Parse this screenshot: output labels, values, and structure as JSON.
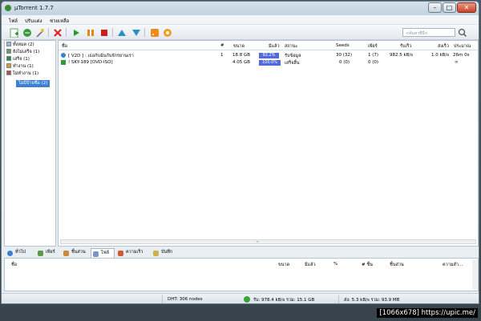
{
  "window": {
    "title": "µTorrent 1.7.7"
  },
  "menubar": {
    "items": [
      "ไฟล์",
      "ปรับแต่ง",
      "ช่วยเหลือ"
    ]
  },
  "toolbar": {
    "search_placeholder": "<ค้นหาที่นี่>"
  },
  "sidebar": {
    "categories": [
      {
        "label": "ทั้งหมด (2)",
        "icon": "all-icon"
      },
      {
        "label": "ยังไม่เสร็จ (1)",
        "icon": "downloading-icon"
      },
      {
        "label": "เสร็จ (1)",
        "icon": "completed-icon"
      },
      {
        "label": "ทำงาน (1)",
        "icon": "active-icon"
      },
      {
        "label": "ไม่ทำงาน (1)",
        "icon": "inactive-icon"
      }
    ],
    "selected": "ไม่มีป้ายชื่อ (2)"
  },
  "columns": {
    "name": "ชื่อ",
    "num": "#",
    "size": "ขนาด",
    "done": "มีแล้ว",
    "status": "สถานะ",
    "seeds": "Seeds",
    "peers": "เพียร์",
    "down": "รับเร็ว",
    "up": "ส่งเร็ว",
    "eta": "ประมาณ"
  },
  "torrents": [
    {
      "name": "[ V2D ] : เธอกับฉันกับจักรยานเรา",
      "num": "1",
      "size": "18.8 GB",
      "done": "92.2%",
      "done_fraction": 0.922,
      "status": "รับข้อมูล",
      "seeds": "30 (32)",
      "peers": "1 (7)",
      "down": "982.5 kB/s",
      "up": "1.0 kB/s",
      "eta": "26m 0s"
    },
    {
      "name": "! SKY-189 [DVD-ISO]",
      "num": "",
      "size": "4.05 GB",
      "done": "100.0%",
      "done_fraction": 1.0,
      "status": "เสร็จสิ้น",
      "seeds": "0 (0)",
      "peers": "0 (0)",
      "down": "",
      "up": "",
      "eta": "∞"
    }
  ],
  "tabs": [
    "ทั่วไป",
    "เพียร์",
    "ชิ้นส่วน",
    "ไฟล์",
    "ความเร็ว",
    "บันทึก"
  ],
  "detail_columns": {
    "name": "ชื่อ",
    "size": "ขนาด",
    "done": "มีแล้ว",
    "pct": "%",
    "pieces": "# ชิ้น",
    "pieces2": "ชิ้นส่วน",
    "priority": "ความสำ..."
  },
  "statusbar": {
    "dht": "DHT: 306 nodes",
    "down": "รับ: 978.4 kB/s รวม: 15.1 GB",
    "up": "ส่ง: 5.3 kB/s รวม: 93.9 MB"
  },
  "watermark": "[1066x678] https://upic.me/",
  "colors": {
    "progress": "#4f6bdc",
    "selection": "#3c80d2",
    "close": "#c7452a"
  }
}
